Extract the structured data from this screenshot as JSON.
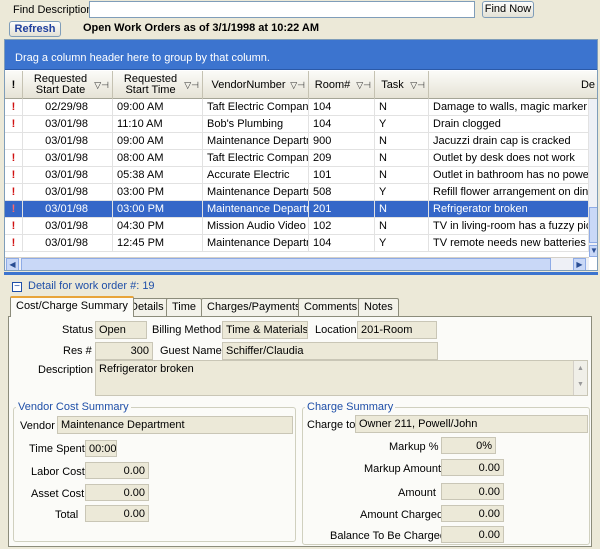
{
  "find": {
    "label": "Find Description",
    "value": "",
    "button": "Find Now"
  },
  "refresh_label": "Refresh",
  "heading": "Open Work Orders as of 3/1/1998 at 10:22 AM",
  "group_hint": "Drag a column header here to group by that column.",
  "columns": {
    "flag": "!",
    "start_date": "Requested Start Date",
    "start_time": "Requested Start Time",
    "vendor": "VendorNumber",
    "room": "Room#",
    "task": "Task",
    "desc": "De"
  },
  "filter_icon": "filter-pin-icon",
  "rows": [
    {
      "flag": "!",
      "date": "02/29/98",
      "time": "09:00 AM",
      "vendor": "Taft Electric Company",
      "room": "104",
      "task": "N",
      "desc": "Damage to walls, magic marker strea"
    },
    {
      "flag": "!",
      "date": "03/01/98",
      "time": "11:10 AM",
      "vendor": "Bob's Plumbing",
      "room": "104",
      "task": "Y",
      "desc": "Drain clogged"
    },
    {
      "flag": "",
      "date": "03/01/98",
      "time": "09:00 AM",
      "vendor": "Maintenance Departme",
      "room": "900",
      "task": "N",
      "desc": "Jacuzzi drain cap is cracked"
    },
    {
      "flag": "!",
      "date": "03/01/98",
      "time": "08:00 AM",
      "vendor": "Taft Electric Company",
      "room": "209",
      "task": "N",
      "desc": "Outlet by desk does not work"
    },
    {
      "flag": "!",
      "date": "03/01/98",
      "time": "05:38 AM",
      "vendor": "Accurate Electric",
      "room": "101",
      "task": "N",
      "desc": "Outlet in bathroom has no power."
    },
    {
      "flag": "!",
      "date": "03/01/98",
      "time": "03:00 PM",
      "vendor": "Maintenance Departme",
      "room": "508",
      "task": "Y",
      "desc": "Refill flower arrangement on dining t"
    },
    {
      "flag": "!",
      "date": "03/01/98",
      "time": "03:00 PM",
      "vendor": "Maintenance Departme",
      "room": "201",
      "task": "N",
      "desc": "Refrigerator broken",
      "selected": true
    },
    {
      "flag": "!",
      "date": "03/01/98",
      "time": "04:30 PM",
      "vendor": "Mission Audio Video",
      "room": "102",
      "task": "N",
      "desc": "TV in living-room has a fuzzy picture"
    },
    {
      "flag": "!",
      "date": "03/01/98",
      "time": "12:45 PM",
      "vendor": "Maintenance Departme",
      "room": "104",
      "task": "Y",
      "desc": "TV remote needs new batteries"
    }
  ],
  "detail": {
    "title": "Detail for work order #: 19",
    "tabs": [
      "Cost/Charge Summary",
      "Details",
      "Time",
      "Charges/Payments",
      "Comments",
      "Notes"
    ],
    "status_label": "Status",
    "status": "Open",
    "billing_label": "Billing Method",
    "billing": "Time & Materials",
    "location_label": "Location",
    "location": "201-Room",
    "res_label": "Res #",
    "res": "300",
    "guest_label": "Guest Name",
    "guest": "Schiffer/Claudia",
    "description_label": "Description",
    "description": "Refrigerator broken",
    "vendor_summary": {
      "title": "Vendor Cost Summary",
      "vendor_label": "Vendor",
      "vendor": "Maintenance Department",
      "time_spent_label": "Time Spent",
      "time_spent": "00:00",
      "labor_label": "Labor Cost",
      "labor": "0.00",
      "asset_label": "Asset Cost",
      "asset": "0.00",
      "total_label": "Total",
      "total": "0.00"
    },
    "charge_summary": {
      "title": "Charge Summary",
      "charge_to_label": "Charge to",
      "charge_to": "Owner 211, Powell/John",
      "markup_pct_label": "Markup %",
      "markup_pct": "0%",
      "markup_amount_label": "Markup Amount",
      "markup_amount": "0.00",
      "amount_label": "Amount",
      "amount": "0.00",
      "amount_charged_label": "Amount Charged",
      "amount_charged": "0.00",
      "balance_label": "Balance To Be Charged",
      "balance": "0.00"
    }
  }
}
